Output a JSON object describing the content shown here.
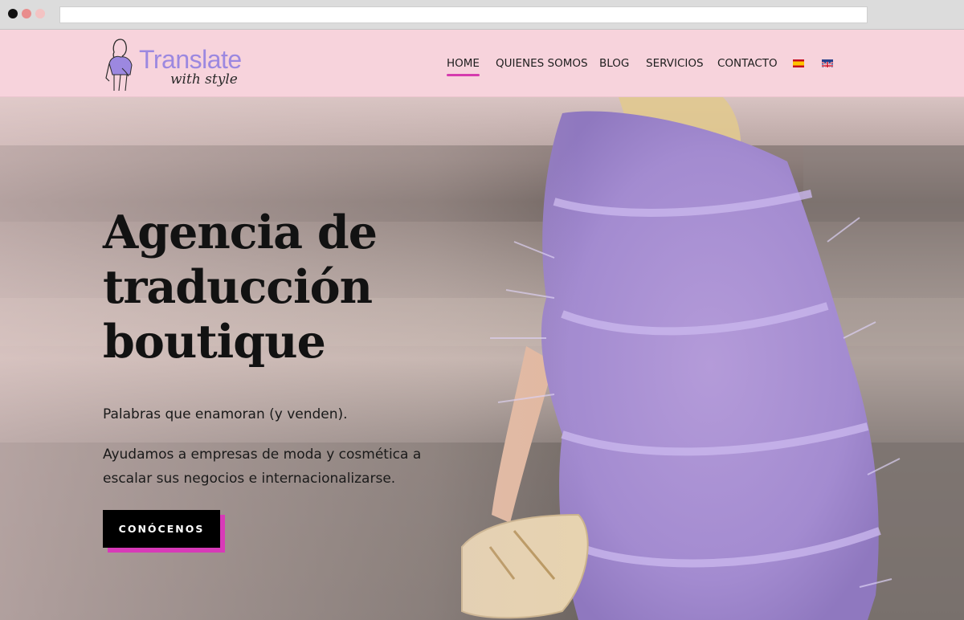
{
  "header": {
    "logo": {
      "wordmark": "Translate",
      "tagline": "with style",
      "brand_color": "#9c88e0"
    },
    "nav": {
      "items": [
        {
          "label": "HOME",
          "active": true
        },
        {
          "label": "QUIENES SOMOS",
          "active": false
        },
        {
          "label": "BLOG",
          "active": false
        },
        {
          "label": "SERVICIOS",
          "active": false
        },
        {
          "label": "CONTACTO",
          "active": false
        }
      ],
      "flags": [
        "spanish-flag-icon",
        "english-flag-icon"
      ],
      "active_underline_color": "#d63cae"
    },
    "background_color": "#f7d3dc"
  },
  "hero": {
    "title_lines": [
      "Agencia de",
      "traducción",
      "boutique"
    ],
    "tagline": "Palabras que enamoran (y venden).",
    "description": "Ayudamos a empresas de moda y cosmética a escalar sus negocios e internacionalizarse.",
    "cta_label": "CONÓCENOS",
    "cta_color": "#000000",
    "cta_shadow_color": "#d83ab8",
    "image": "woman-in-lilac-feather-dress-photo"
  }
}
